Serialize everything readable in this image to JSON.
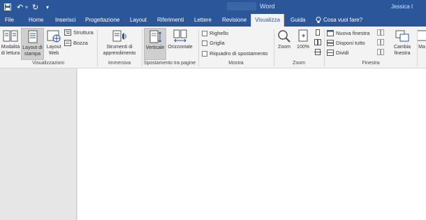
{
  "window": {
    "title": "Word",
    "user": "Jessica I"
  },
  "tabs": [
    {
      "label": "File",
      "active": false
    },
    {
      "label": "Home",
      "active": false
    },
    {
      "label": "Inserisci",
      "active": false
    },
    {
      "label": "Progettazione",
      "active": false
    },
    {
      "label": "Layout",
      "active": false
    },
    {
      "label": "Riferimenti",
      "active": false
    },
    {
      "label": "Lettere",
      "active": false
    },
    {
      "label": "Revisione",
      "active": false
    },
    {
      "label": "Visualizza",
      "active": true
    },
    {
      "label": "Guida",
      "active": false
    },
    {
      "label": "Cosa vuoi fare?",
      "active": false
    }
  ],
  "groups": {
    "visualizzazioni": {
      "label": "Visualizzazioni",
      "lettura": "Modalità di lettura",
      "stampa": "Layout di stampa",
      "web": "Layout Web",
      "struttura": "Struttura",
      "bozza": "Bozza"
    },
    "immersiva": {
      "label": "Immersiva",
      "strumenti": "Strumenti di apprendimento"
    },
    "spostamento": {
      "label": "Spostamento tra pagine",
      "verticale": "Verticale",
      "orizzontale": "Orizzontale"
    },
    "mostra": {
      "label": "Mostra",
      "righello": "Righello",
      "griglia": "Griglia",
      "riquadro": "Riquadro di spostamento"
    },
    "zoom": {
      "label": "Zoom",
      "zoom": "Zoom",
      "percent": "100%"
    },
    "finestra": {
      "label": "Finestra",
      "nuova": "Nuova finestra",
      "disponi": "Disponi tutto",
      "dividi": "Dividi",
      "cambia": "Cambia finestra",
      "macro": "Ma"
    }
  },
  "colors": {
    "accent": "#2b579a",
    "ribbon": "#f3f3f3",
    "document": "#ffffff"
  }
}
